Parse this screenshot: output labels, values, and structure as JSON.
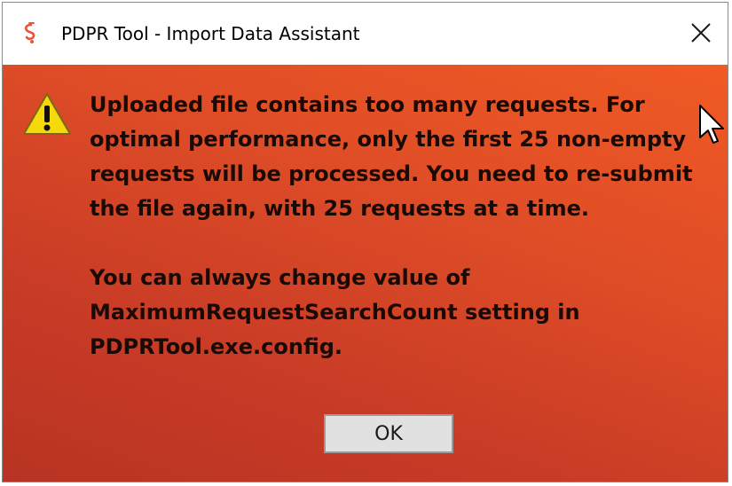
{
  "window": {
    "title": "PDPR Tool - Import Data Assistant"
  },
  "message": {
    "lines": [
      "Uploaded file contains too many requests. For",
      "optimal performance, only the first 25 non-empty",
      "requests will be processed. You need to re-submit",
      "the file again, with 25 requests at a time."
    ],
    "lines2": [
      "You can always change value of",
      "MaximumRequestSearchCount setting in",
      "PDPRTool.exe.config."
    ]
  },
  "buttons": {
    "ok_label": "OK"
  },
  "icons": {
    "app": "app-logo-icon",
    "warning": "warning-icon",
    "close": "close-icon",
    "cursor": "mouse-cursor-icon"
  },
  "colors": {
    "accent_top": "#f15a24",
    "accent_bottom": "#b83324",
    "warning_yellow": "#f5d90a"
  }
}
